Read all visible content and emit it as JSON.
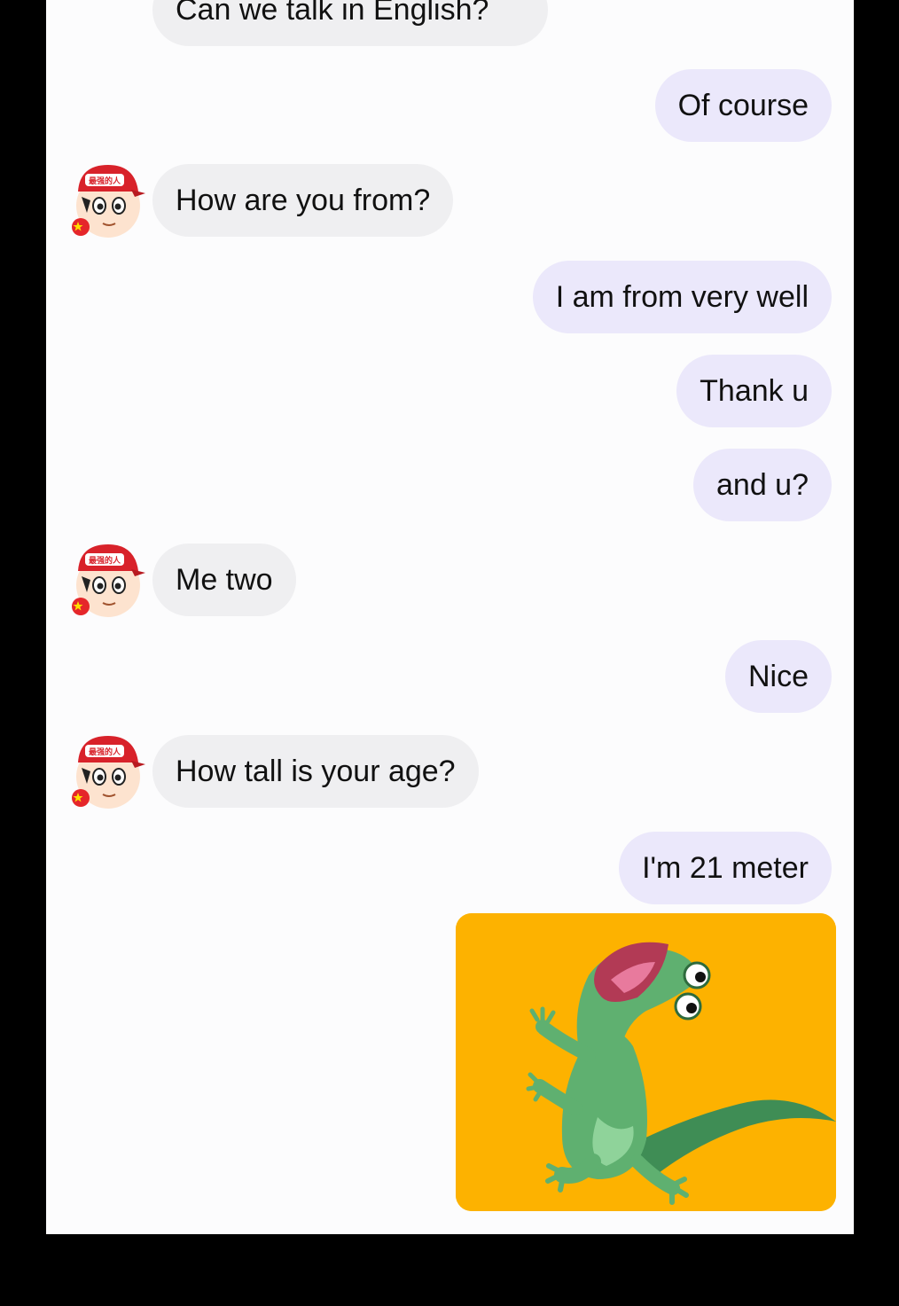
{
  "conversation": {
    "messages": [
      {
        "side": "in",
        "text": "Can we talk in English?"
      },
      {
        "side": "out",
        "text": "Of course"
      },
      {
        "side": "in",
        "text": "How are you from?"
      },
      {
        "side": "out",
        "text": "I am from very well"
      },
      {
        "side": "out",
        "text": "Thank u"
      },
      {
        "side": "out",
        "text": "and u?"
      },
      {
        "side": "in",
        "text": "Me two"
      },
      {
        "side": "out",
        "text": "Nice"
      },
      {
        "side": "in",
        "text": "How tall is your age?"
      },
      {
        "side": "out",
        "text": "I'm 21 meter"
      }
    ],
    "avatar_cap_text": "最强的人",
    "sticker": {
      "icon": "lizard-sticker-icon",
      "background": "#fdb200"
    }
  },
  "colors": {
    "incoming_bubble": "#efeff1",
    "outgoing_bubble": "#ebe8fb",
    "background": "#fcfcfd"
  }
}
